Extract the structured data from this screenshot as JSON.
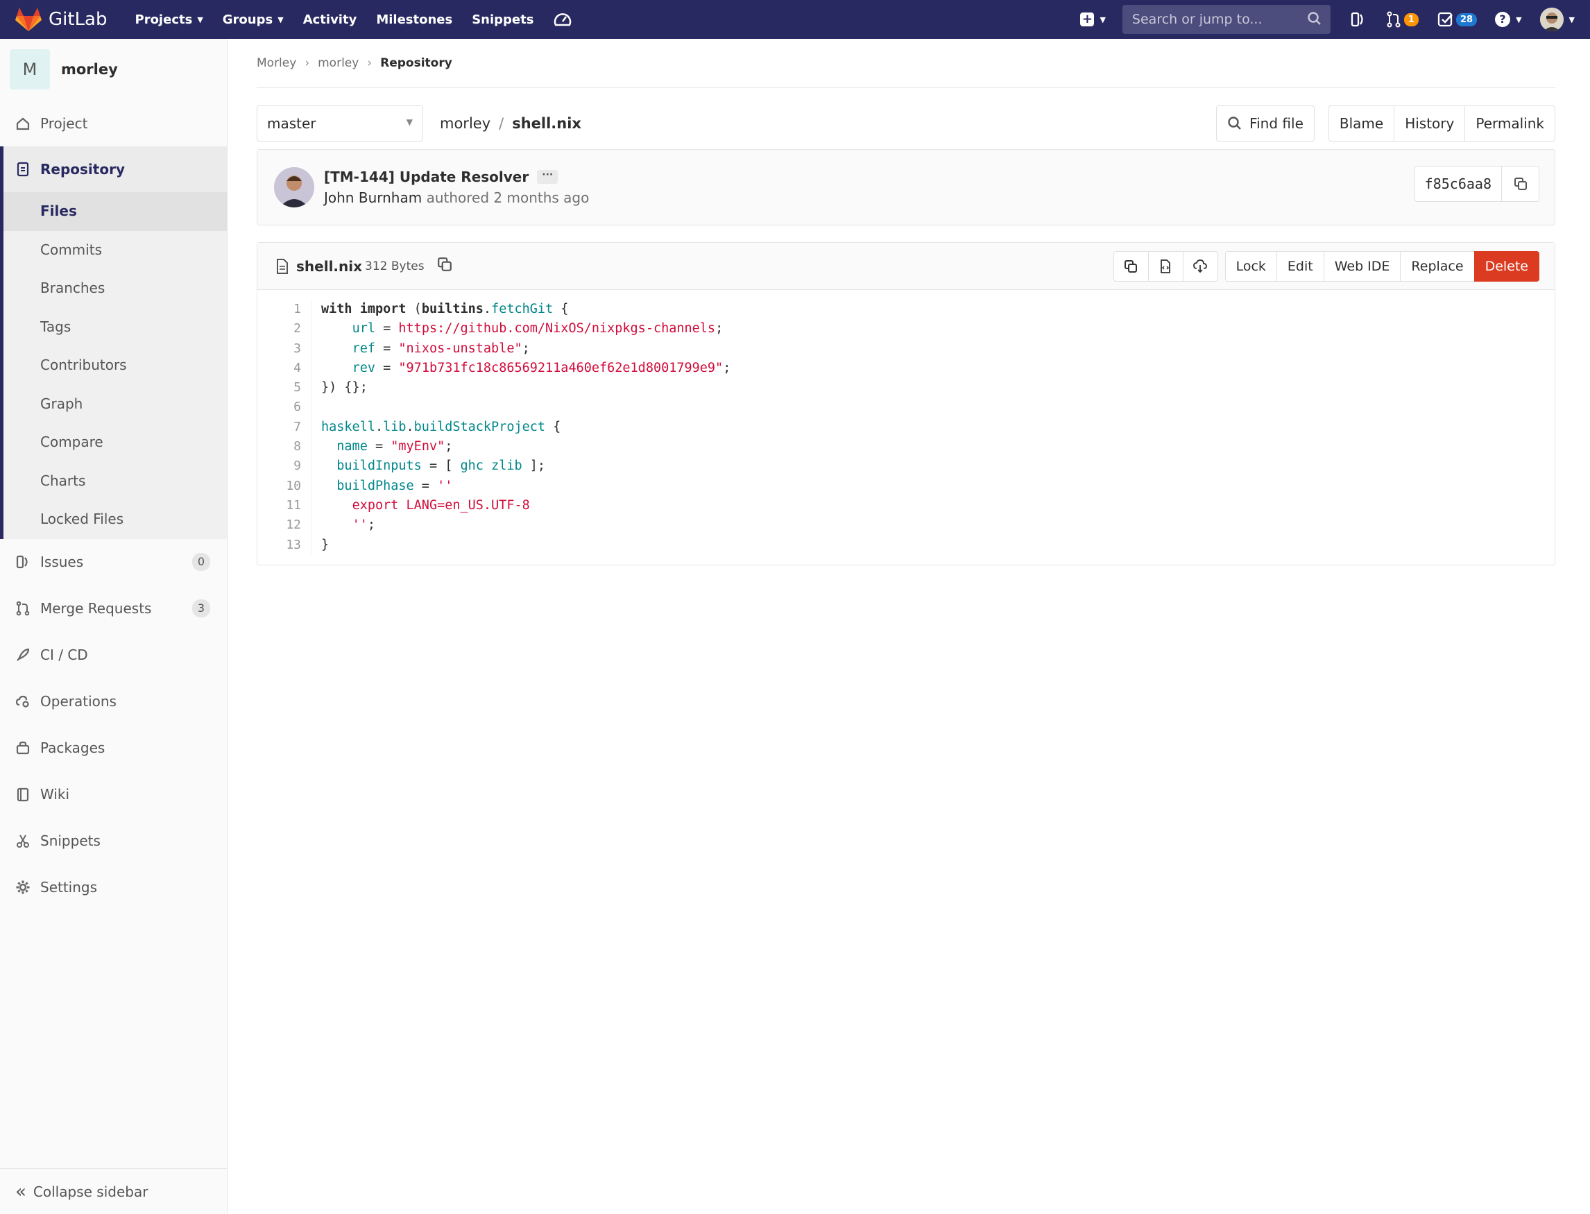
{
  "navbar": {
    "brand": "GitLab",
    "links": [
      {
        "label": "Projects",
        "dropdown": true
      },
      {
        "label": "Groups",
        "dropdown": true
      },
      {
        "label": "Activity",
        "dropdown": false
      },
      {
        "label": "Milestones",
        "dropdown": false
      },
      {
        "label": "Snippets",
        "dropdown": false
      }
    ],
    "search_placeholder": "Search or jump to...",
    "merge_requests_count": "1",
    "todos_count": "28",
    "accent_color": "#292961"
  },
  "sidebar": {
    "project_initial": "M",
    "project_name": "morley",
    "items_top": [
      {
        "label": "Project",
        "icon": "home-icon"
      }
    ],
    "repository": {
      "label": "Repository",
      "icon": "repository-icon",
      "sub_items": [
        "Files",
        "Commits",
        "Branches",
        "Tags",
        "Contributors",
        "Graph",
        "Compare",
        "Charts",
        "Locked Files"
      ],
      "active_sub": "Files"
    },
    "items_bottom": [
      {
        "label": "Issues",
        "icon": "issues-icon",
        "count": "0"
      },
      {
        "label": "Merge Requests",
        "icon": "merge-request-icon",
        "count": "3"
      },
      {
        "label": "CI / CD",
        "icon": "rocket-icon",
        "count": null
      },
      {
        "label": "Operations",
        "icon": "cloud-gear-icon",
        "count": null
      },
      {
        "label": "Packages",
        "icon": "package-icon",
        "count": null
      },
      {
        "label": "Wiki",
        "icon": "book-icon",
        "count": null
      },
      {
        "label": "Snippets",
        "icon": "scissors-icon",
        "count": null
      },
      {
        "label": "Settings",
        "icon": "gear-icon",
        "count": null
      }
    ],
    "collapse_label": "Collapse sidebar"
  },
  "breadcrumb": [
    "Morley",
    "morley",
    "Repository"
  ],
  "tree": {
    "branch": "master",
    "path_root": "morley",
    "path_file": "shell.nix",
    "find_file_label": "Find file",
    "blame_label": "Blame",
    "history_label": "History",
    "permalink_label": "Permalink"
  },
  "commit": {
    "title": "[TM-144] Update Resolver",
    "author": "John Burnham",
    "meta": "authored 2 months ago",
    "sha": "f85c6aa8"
  },
  "file": {
    "name": "shell.nix",
    "size": "312 Bytes",
    "actions": [
      "Lock",
      "Edit",
      "Web IDE",
      "Replace"
    ],
    "delete_label": "Delete",
    "delete_color": "#db3b21",
    "line_count": 13
  }
}
